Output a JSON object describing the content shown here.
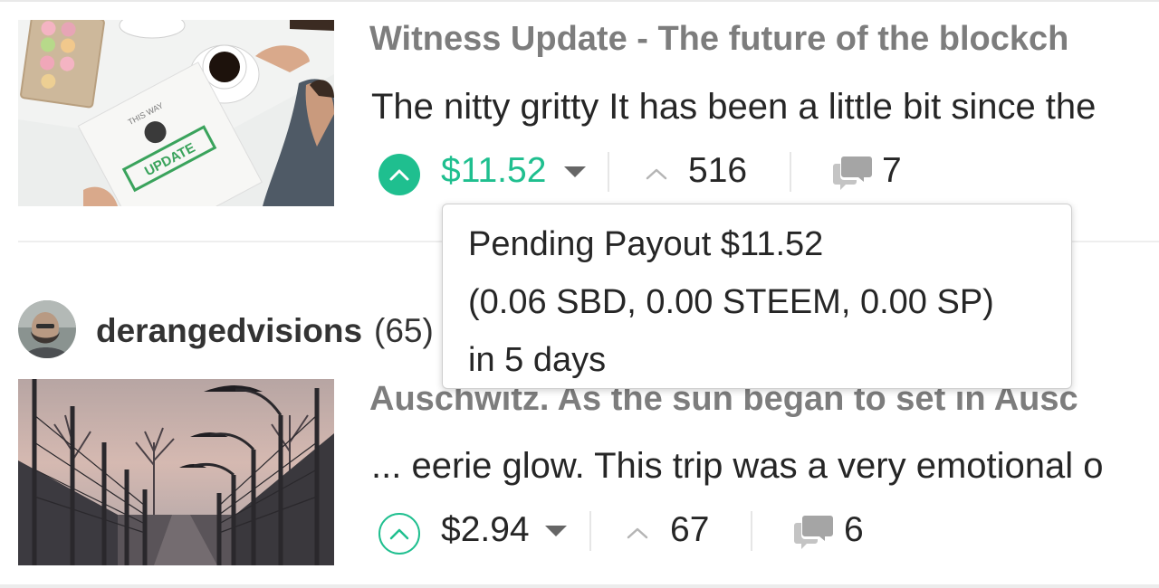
{
  "colors": {
    "accent_green": "#1fbf8f",
    "title_gray": "#7d7d7d",
    "text_dark": "#262626"
  },
  "posts": [
    {
      "title": "Witness Update - The future of the blockch",
      "excerpt": "The nitty gritty It has been a little bit since the",
      "upvoted": true,
      "payout": "$11.52",
      "votes": "516",
      "replies": "7",
      "thumbnail": {
        "stamp_text": "UPDATE",
        "paper_caption": "THIS WAY"
      }
    },
    {
      "author": {
        "name": "derangedvisions",
        "reputation": "(65)"
      },
      "title": "Auschwitz. As the sun began to set in Ausc",
      "excerpt": "... eerie glow. This trip was a very emotional o",
      "upvoted": false,
      "payout": "$2.94",
      "votes": "67",
      "replies": "6"
    }
  ],
  "tooltip": {
    "line1": "Pending Payout $11.52",
    "line2": "(0.06 SBD, 0.00 STEEM, 0.00 SP)",
    "line3": "in 5 days"
  },
  "icons": {
    "upvote": "chevron-up-circle-icon",
    "dropdown": "caret-down-icon",
    "votes": "chevron-up-icon",
    "replies": "chat-bubbles-icon"
  }
}
